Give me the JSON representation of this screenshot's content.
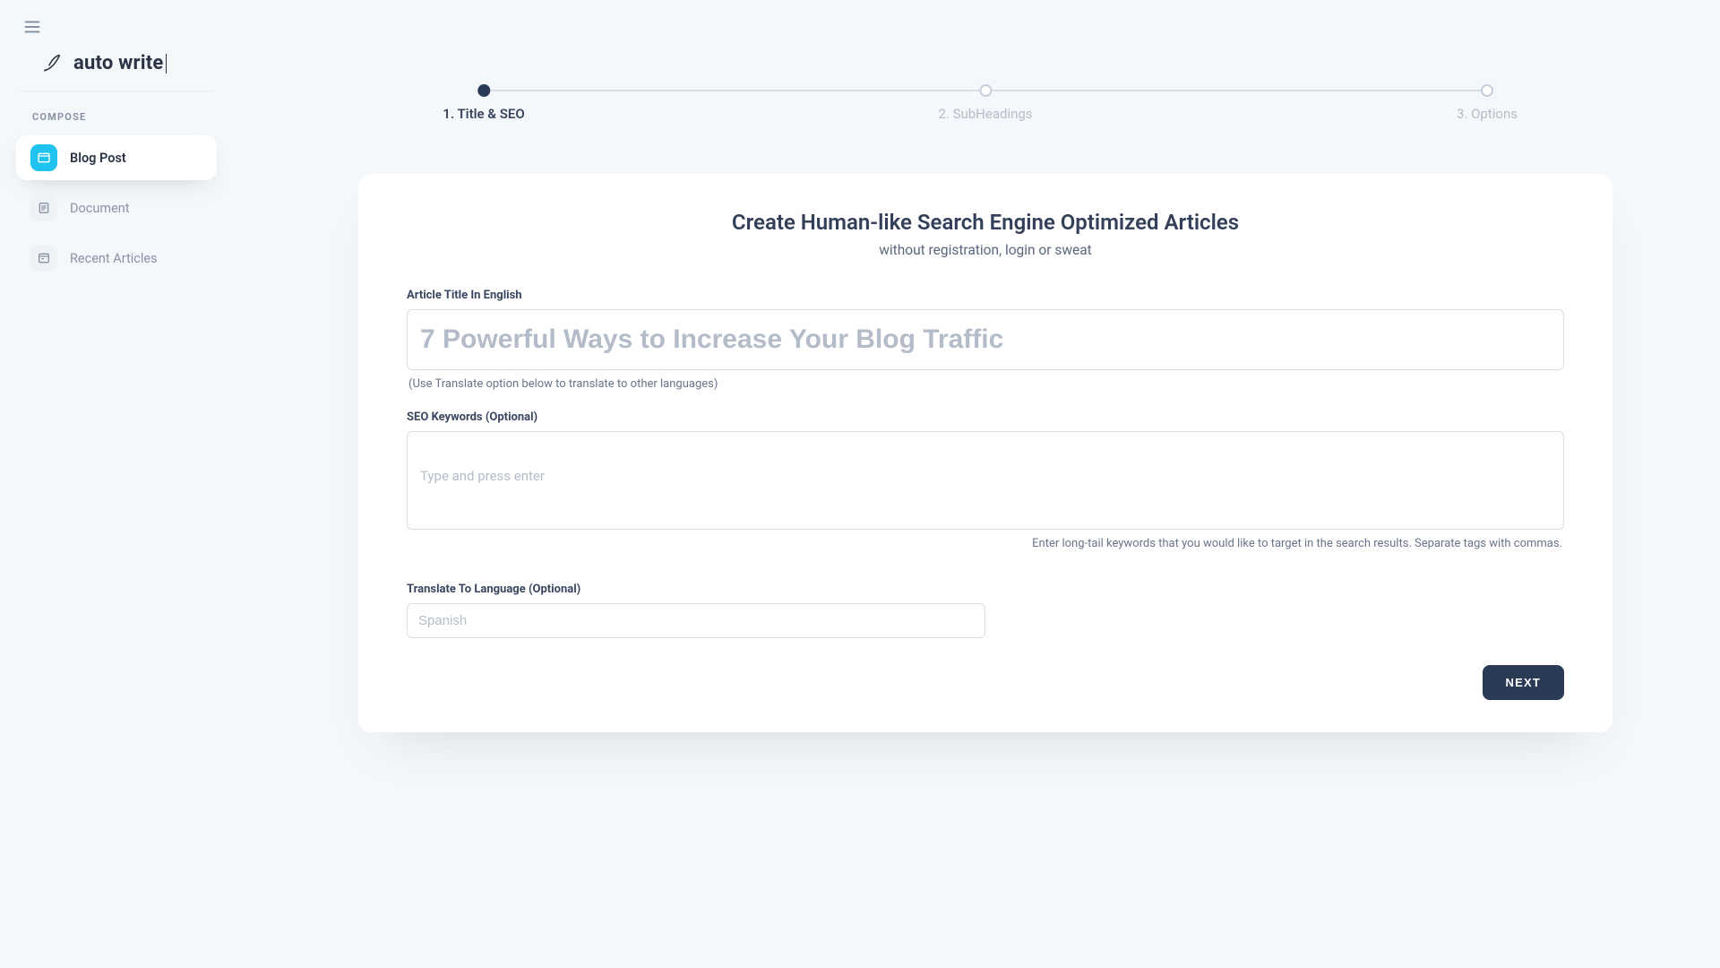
{
  "brand": {
    "name": "auto write"
  },
  "sidebar": {
    "section_label": "COMPOSE",
    "items": [
      {
        "label": "Blog Post"
      },
      {
        "label": "Document"
      },
      {
        "label": "Recent Articles"
      }
    ]
  },
  "stepper": {
    "steps": [
      {
        "label": "1. Title & SEO"
      },
      {
        "label": "2. SubHeadings"
      },
      {
        "label": "3. Options"
      }
    ]
  },
  "card": {
    "heading": "Create Human-like Search Engine Optimized Articles",
    "subheading": "without registration, login or sweat",
    "fields": {
      "title": {
        "label": "Article Title In English",
        "placeholder": "7 Powerful Ways to Increase Your Blog Traffic",
        "value": "",
        "hint": "(Use Translate option below to translate to other languages)"
      },
      "keywords": {
        "label": "SEO Keywords (Optional)",
        "placeholder": "Type and press enter",
        "hint": "Enter long-tail keywords that you would like to target in the search results. Separate tags with commas."
      },
      "language": {
        "label": "Translate To Language (Optional)",
        "placeholder": "Spanish",
        "value": ""
      }
    },
    "next_label": "NEXT"
  }
}
